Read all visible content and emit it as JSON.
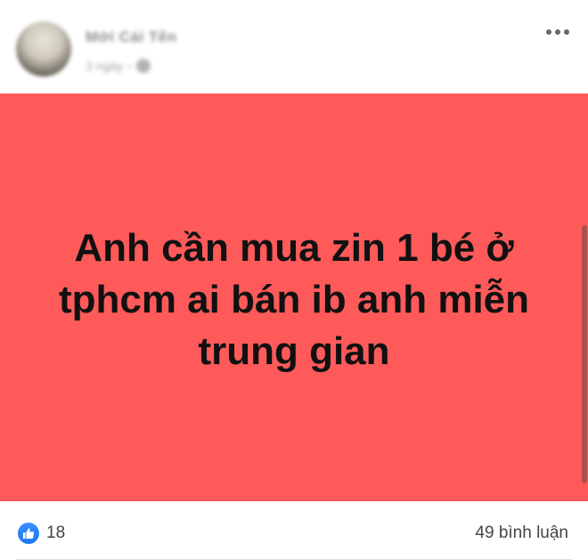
{
  "header": {
    "author_name": "Mới Cái Tên",
    "post_time": "3 ngày",
    "avatar_icon": "avatar-image",
    "privacy_icon": "globe-icon",
    "more_icon": "more-horizontal-icon"
  },
  "post": {
    "background_color": "#fe5a5a",
    "text": "Anh cần mua zin 1 bé ở tphcm ai bán ib anh miễn trung gian"
  },
  "footer": {
    "reaction_icon": "like-icon",
    "reaction_count": "18",
    "comments": "49 bình luận"
  },
  "colors": {
    "accent": "#1877f2",
    "post_background": "#fe5a5a",
    "text_dark": "#111111"
  }
}
